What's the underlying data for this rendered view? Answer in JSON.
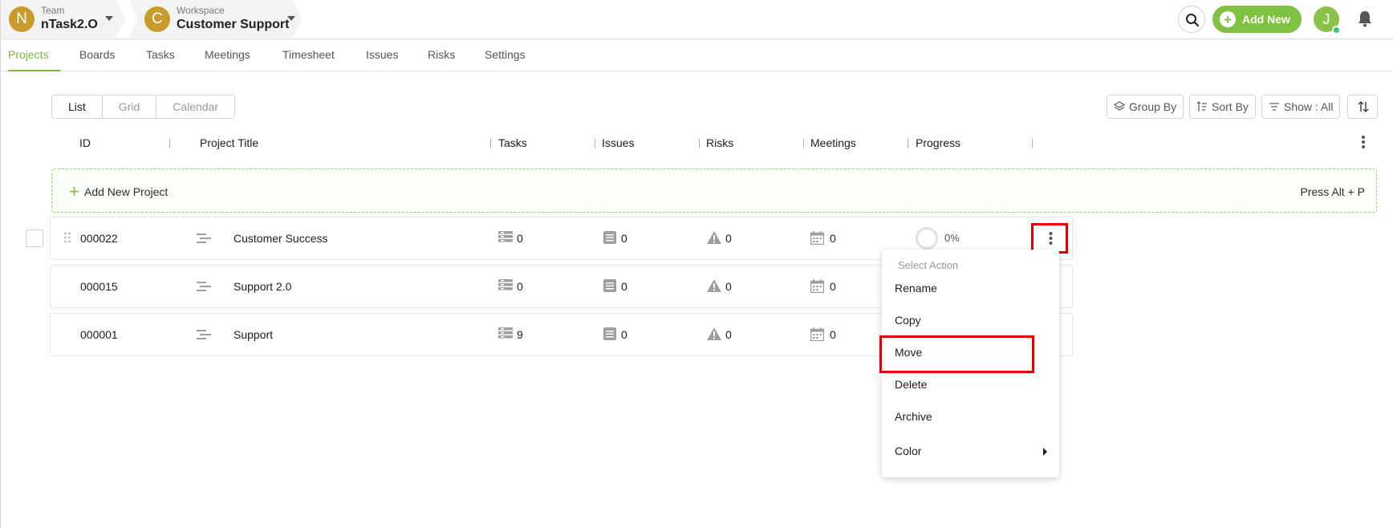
{
  "team": {
    "avatar_letter": "N",
    "label": "Team",
    "name": "nTask2.O"
  },
  "workspace": {
    "avatar_letter": "C",
    "label": "Workspace",
    "name": "Customer Support"
  },
  "header": {
    "add_new_label": "Add New",
    "user_initial": "J"
  },
  "nav": {
    "tabs": [
      "Projects",
      "Boards",
      "Tasks",
      "Meetings",
      "Timesheet",
      "Issues",
      "Risks",
      "Settings"
    ],
    "active": "Projects"
  },
  "views": {
    "list": "List",
    "grid": "Grid",
    "calendar": "Calendar",
    "active": "List"
  },
  "toolbar": {
    "group_by": "Group By",
    "sort_by": "Sort By",
    "show": "Show : All"
  },
  "columns": {
    "id": "ID",
    "title": "Project Title",
    "tasks": "Tasks",
    "issues": "Issues",
    "risks": "Risks",
    "meetings": "Meetings",
    "progress": "Progress"
  },
  "add_project": {
    "label": "Add New Project",
    "hint": "Press Alt + P"
  },
  "projects": [
    {
      "id": "000022",
      "title": "Customer Success",
      "tasks": "0",
      "issues": "0",
      "risks": "0",
      "meetings": "0",
      "progress": "0%"
    },
    {
      "id": "000015",
      "title": "Support 2.0",
      "tasks": "0",
      "issues": "0",
      "risks": "0",
      "meetings": "0"
    },
    {
      "id": "000001",
      "title": "Support",
      "tasks": "9",
      "issues": "0",
      "risks": "0",
      "meetings": "0"
    }
  ],
  "menu": {
    "title": "Select Action",
    "items": [
      "Rename",
      "Copy",
      "Move",
      "Delete",
      "Archive",
      "Color"
    ],
    "highlighted": "Move"
  },
  "colors": {
    "accent": "#7fc241",
    "highlight": "#e00000",
    "team_avatar": "#c89b2c"
  }
}
